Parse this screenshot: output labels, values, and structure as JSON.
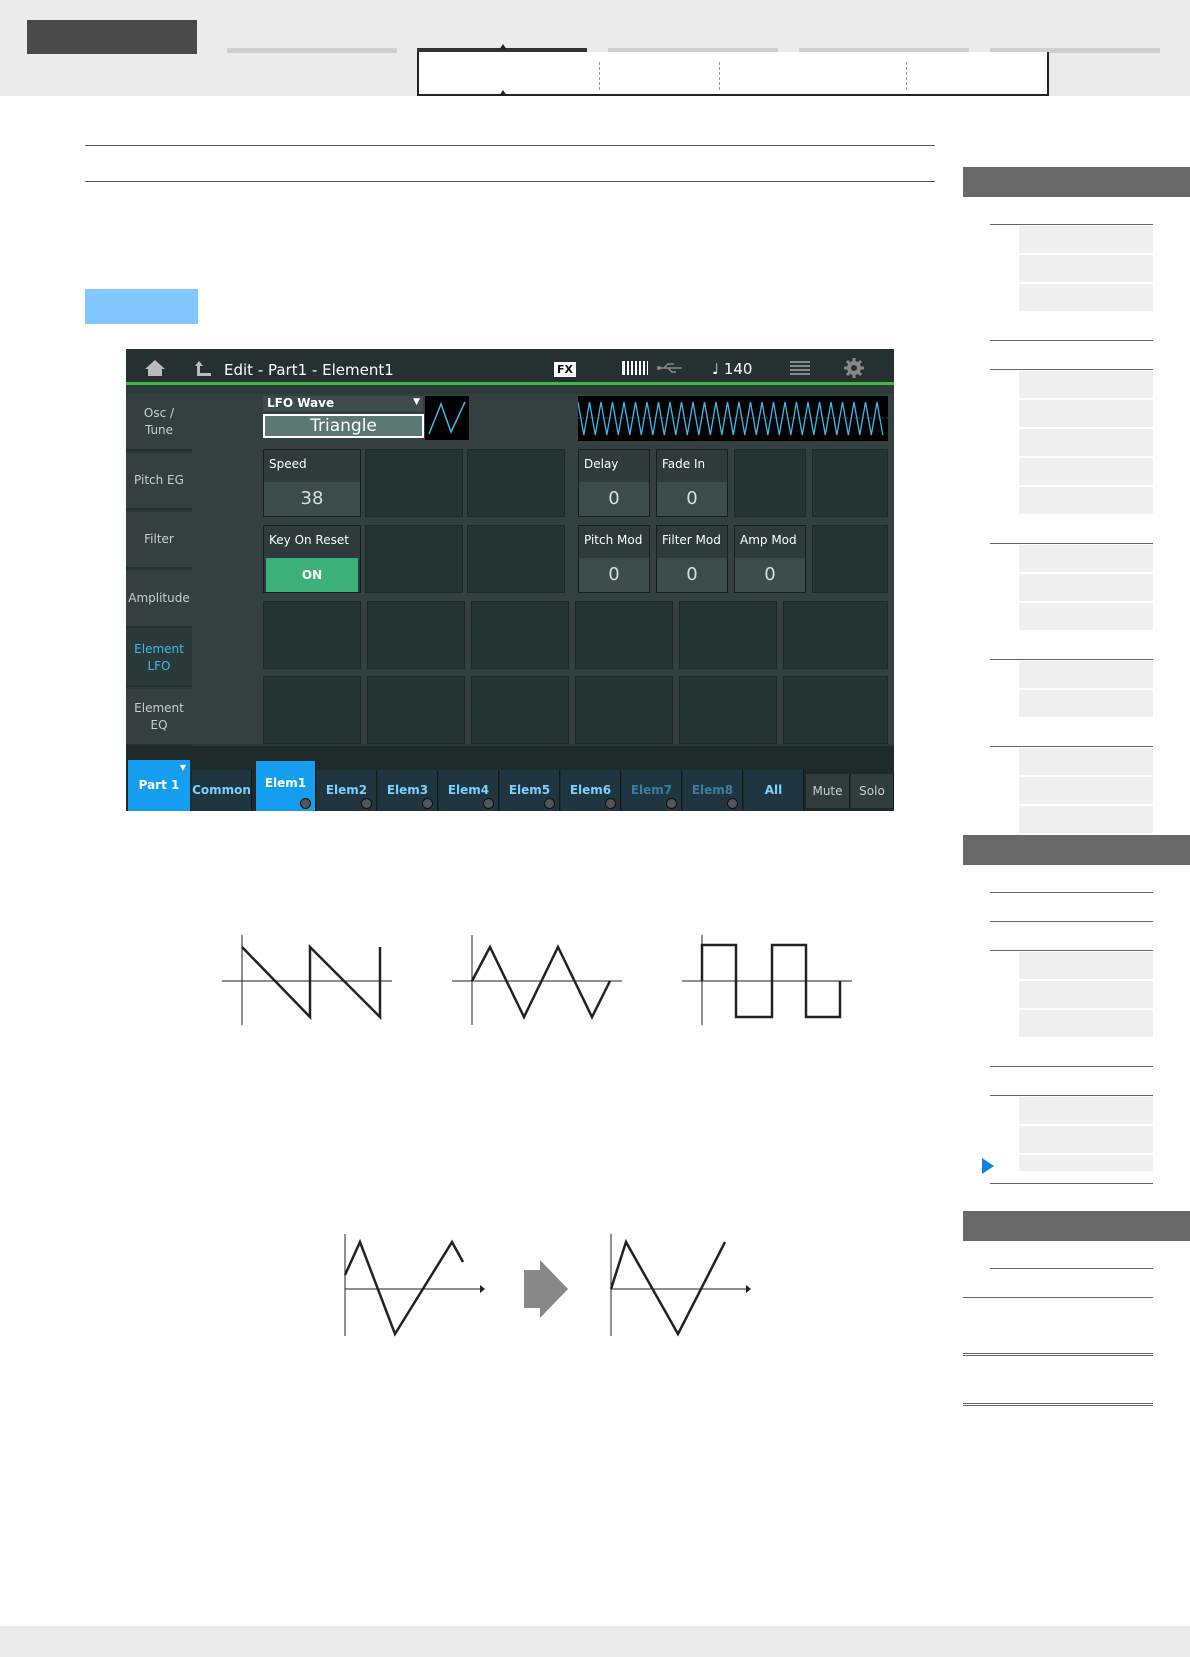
{
  "screen": {
    "title": "Edit - Part1 - Element1",
    "fx_badge": "FX",
    "tempo": "♩ 140",
    "left_tabs": [
      {
        "line1": "Osc /",
        "line2": "Tune"
      },
      {
        "line1": "Pitch EG",
        "line2": ""
      },
      {
        "line1": "Filter",
        "line2": ""
      },
      {
        "line1": "Amplitude",
        "line2": ""
      },
      {
        "line1": "Element",
        "line2": "LFO"
      },
      {
        "line1": "Element",
        "line2": "EQ"
      }
    ],
    "lfo_wave": {
      "label": "LFO Wave",
      "value": "Triangle"
    },
    "speed": {
      "label": "Speed",
      "value": "38"
    },
    "key_on_reset": {
      "label": "Key On Reset",
      "value": "ON"
    },
    "delay": {
      "label": "Delay",
      "value": "0"
    },
    "fade_in": {
      "label": "Fade In",
      "value": "0"
    },
    "pitch_mod": {
      "label": "Pitch Mod",
      "value": "0"
    },
    "filter_mod": {
      "label": "Filter Mod",
      "value": "0"
    },
    "amp_mod": {
      "label": "Amp Mod",
      "value": "0"
    },
    "bottom": {
      "part": "Part 1",
      "common": "Common",
      "elems": [
        "Elem1",
        "Elem2",
        "Elem3",
        "Elem4",
        "Elem5",
        "Elem6",
        "Elem7",
        "Elem8"
      ],
      "all": "All",
      "mute": "Mute",
      "solo": "Solo"
    }
  },
  "colors": {
    "accent_blue": "#159ef0",
    "on_green": "#3cb079",
    "status_green": "#40b848",
    "toc_arrow": "#0a84d8",
    "tag_blue": "#82c8ff"
  },
  "icons": [
    "home-icon",
    "back-icon",
    "keyboard-icon",
    "usb-icon",
    "grid-icon",
    "gear-icon",
    "arrow-right-icon"
  ]
}
